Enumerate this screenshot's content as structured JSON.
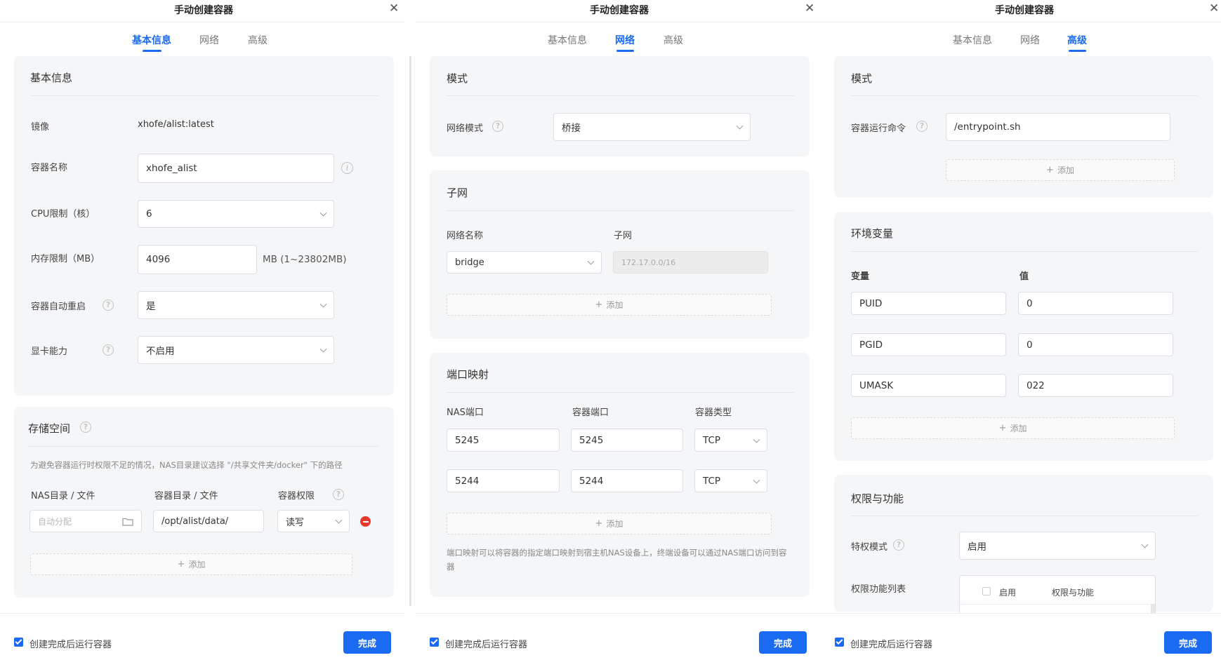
{
  "panel1": {
    "title": "手动创建容器",
    "tabs": [
      "基本信息",
      "网络",
      "高级"
    ],
    "basic": {
      "title": "基本信息",
      "image_label": "镜像",
      "image_value": "xhofe/alist:latest",
      "name_label": "容器名称",
      "name_value": "xhofe_alist",
      "cpu_label": "CPU限制（核）",
      "cpu_value": "6",
      "mem_label": "内存限制（MB）",
      "mem_value": "4096",
      "mem_suffix": "MB (1~23802MB)",
      "restart_label": "容器自动重启",
      "restart_value": "是",
      "gpu_label": "显卡能力",
      "gpu_value": "不启用"
    },
    "storage": {
      "title": "存储空间",
      "hint": "为避免容器运行时权限不足的情况，NAS目录建议选择 \"/共享文件夹/docker\" 下的路径",
      "col_nas": "NAS目录 / 文件",
      "col_container": "容器目录 / 文件",
      "col_perm": "容器权限",
      "nas_placeholder": "自动分配",
      "container_value": "/opt/alist/data/",
      "perm_value": "读写",
      "add": "添加"
    },
    "footer": {
      "checkbox": "创建完成后运行容器",
      "button": "完成"
    }
  },
  "panel2": {
    "title": "手动创建容器",
    "tabs": [
      "基本信息",
      "网络",
      "高级"
    ],
    "mode": {
      "title": "模式",
      "label": "网络模式",
      "value": "桥接"
    },
    "subnet": {
      "title": "子网",
      "col_name": "网络名称",
      "col_subnet": "子网",
      "name_value": "bridge",
      "subnet_value": "172.17.0.0/16",
      "add": "添加"
    },
    "ports": {
      "title": "端口映射",
      "col_nas": "NAS端口",
      "col_container": "容器端口",
      "col_type": "容器类型",
      "rows": [
        {
          "nas": "5245",
          "container": "5245",
          "type": "TCP"
        },
        {
          "nas": "5244",
          "container": "5244",
          "type": "TCP"
        }
      ],
      "add": "添加",
      "hint": "端口映射可以将容器的指定端口映射到宿主机NAS设备上，终端设备可以通过NAS端口访问到容器"
    },
    "footer": {
      "checkbox": "创建完成后运行容器",
      "button": "完成"
    }
  },
  "panel3": {
    "title": "手动创建容器",
    "tabs": [
      "基本信息",
      "网络",
      "高级"
    ],
    "mode": {
      "title": "模式",
      "cmd_label": "容器运行命令",
      "cmd_value": "/entrypoint.sh",
      "add": "添加"
    },
    "env": {
      "title": "环境变量",
      "col_var": "变量",
      "col_val": "值",
      "rows": [
        {
          "key": "PUID",
          "value": "0"
        },
        {
          "key": "PGID",
          "value": "0"
        },
        {
          "key": "UMASK",
          "value": "022"
        }
      ],
      "add": "添加"
    },
    "perm": {
      "title": "权限与功能",
      "priv_label": "特权模式",
      "priv_value": "启用",
      "list_label": "权限功能列表",
      "list_col_enable": "启用",
      "list_col_name": "权限与功能"
    },
    "footer": {
      "checkbox": "创建完成后运行容器",
      "button": "完成"
    }
  },
  "colors": {
    "accent": "#1a6af2",
    "danger": "#e8392d",
    "card": "#f5f6f8"
  }
}
